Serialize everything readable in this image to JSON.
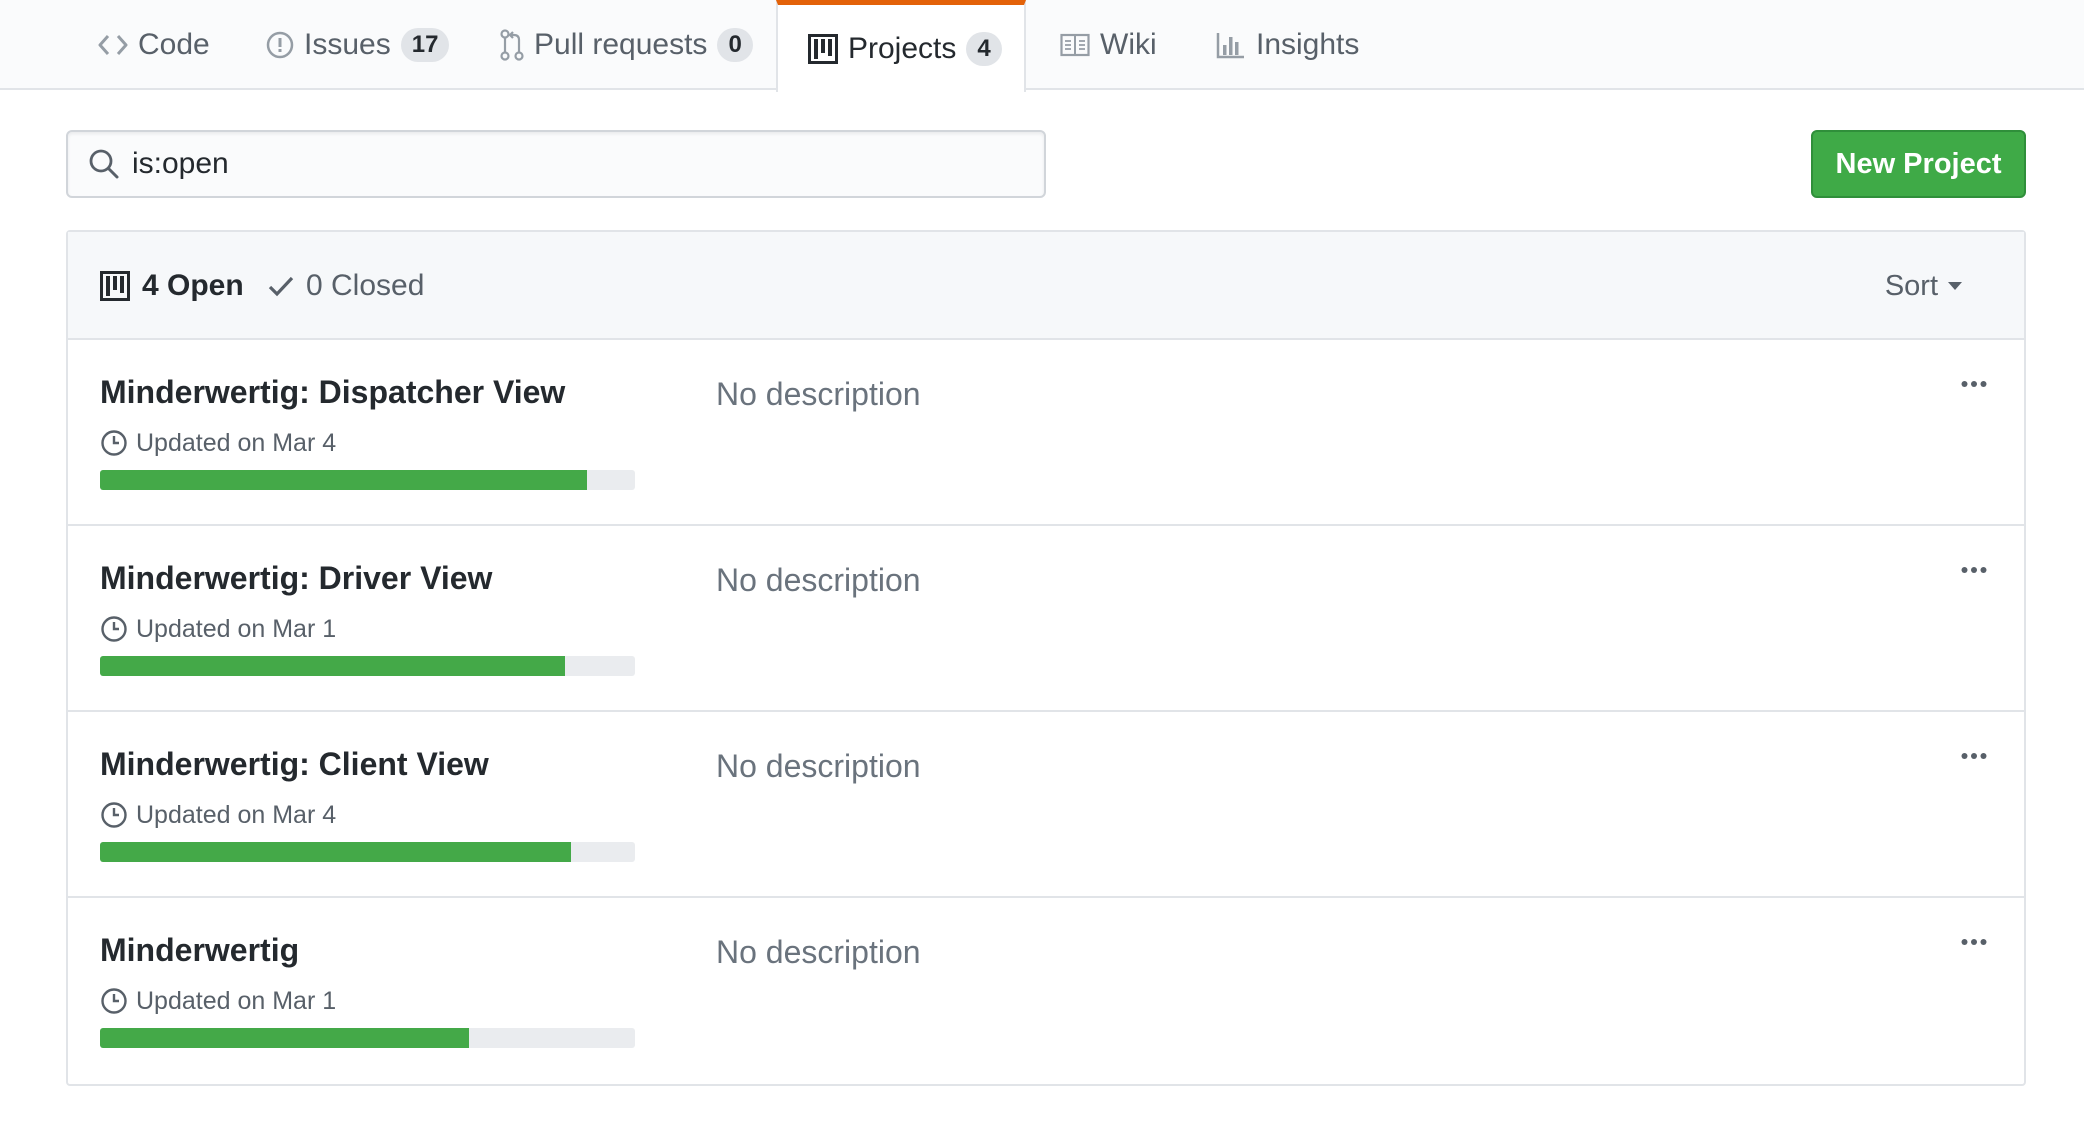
{
  "tabs": [
    {
      "label": "Code",
      "icon": "code-icon"
    },
    {
      "label": "Issues",
      "icon": "issue-opened-icon",
      "count": "17"
    },
    {
      "label": "Pull requests",
      "icon": "git-pull-request-icon",
      "count": "0"
    },
    {
      "label": "Projects",
      "icon": "project-icon",
      "count": "4",
      "selected": true
    },
    {
      "label": "Wiki",
      "icon": "book-icon"
    },
    {
      "label": "Insights",
      "icon": "graph-icon"
    }
  ],
  "search": {
    "value": "is:open",
    "icon": "search-icon"
  },
  "new_project_label": "New Project",
  "list_header": {
    "open_label": "4 Open",
    "closed_label": "0 Closed",
    "sort_label": "Sort"
  },
  "projects": [
    {
      "name": "Minderwertig: Dispatcher View",
      "updated": "Updated on Mar 4",
      "description": "No description",
      "progress": 0.91
    },
    {
      "name": "Minderwertig: Driver View",
      "updated": "Updated on Mar 1",
      "description": "No description",
      "progress": 0.87
    },
    {
      "name": "Minderwertig: Client View",
      "updated": "Updated on Mar 4",
      "description": "No description",
      "progress": 0.88
    },
    {
      "name": "Minderwertig",
      "updated": "Updated on Mar 1",
      "description": "No description",
      "progress": 0.69
    }
  ],
  "colors": {
    "accent_tab": "#e36209",
    "primary_button": "#3faa47",
    "progress_fill": "#44a948",
    "progress_track": "#eaecef"
  }
}
